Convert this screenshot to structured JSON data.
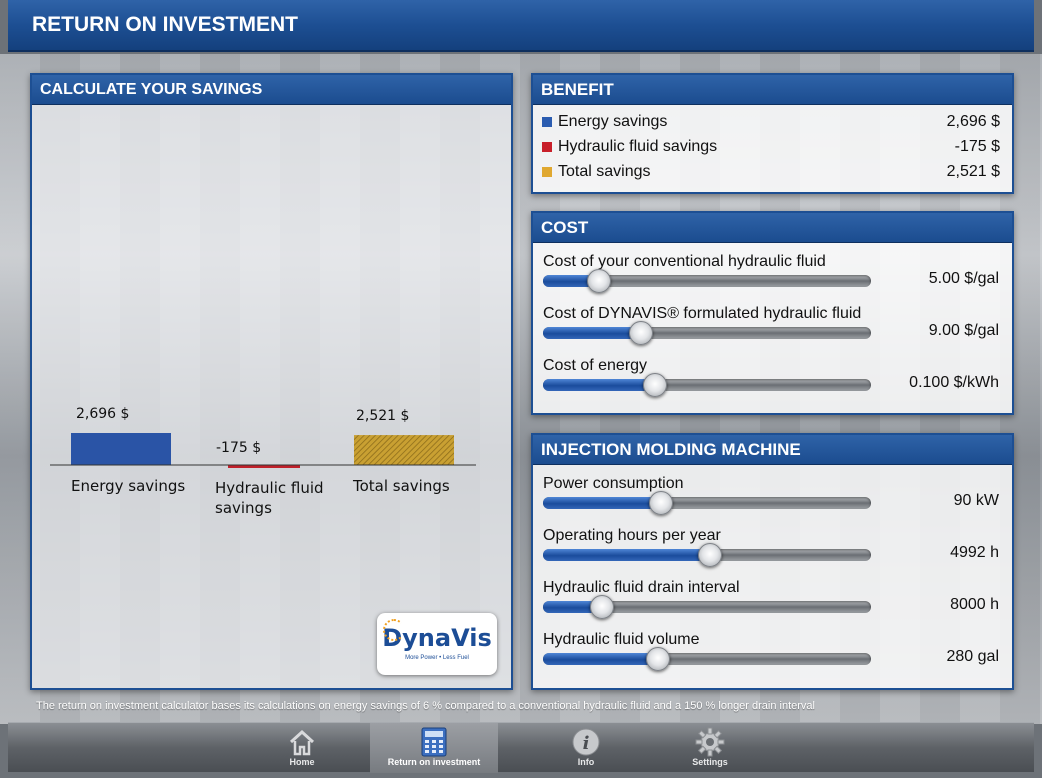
{
  "header": {
    "title": "RETURN ON INVESTMENT"
  },
  "calc": {
    "title": "CALCULATE YOUR SAVINGS",
    "logo": {
      "word": "DynaVis",
      "tagline": "More Power • Less Fuel"
    }
  },
  "chart_data": {
    "type": "bar",
    "categories": [
      "Energy savings",
      "Hydraulic fluid savings",
      "Total savings"
    ],
    "values": [
      2696,
      -175,
      2521
    ],
    "value_labels": [
      "2,696 $",
      "-175 $",
      "2,521 $"
    ],
    "category_labels": [
      "Energy savings",
      "Hydraulic fluid\nsavings",
      "Total savings"
    ],
    "colors": [
      "#2a54a6",
      "#c0202a",
      "#c9a032"
    ]
  },
  "benefit": {
    "title": "BENEFIT",
    "rows": [
      {
        "label": "Energy savings",
        "value": "2,696 $",
        "color": "#2a5cb0"
      },
      {
        "label": "Hydraulic fluid savings",
        "value": "-175 $",
        "color": "#c8202a"
      },
      {
        "label": "Total savings",
        "value": "2,521 $",
        "color": "#e0a830"
      }
    ]
  },
  "cost": {
    "title": "COST",
    "sliders": [
      {
        "label": "Cost of your conventional hydraulic fluid",
        "value": "5.00 $/gal",
        "level": 0.17
      },
      {
        "label": "Cost of DYNAVIS® formulated hydraulic fluid",
        "value": "9.00 $/gal",
        "level": 0.3
      },
      {
        "label": "Cost of energy",
        "value": "0.100 $/kWh",
        "level": 0.34
      }
    ]
  },
  "imm": {
    "title": "INJECTION MOLDING MACHINE",
    "sliders": [
      {
        "label": "Power consumption",
        "value": "90 kW",
        "level": 0.36
      },
      {
        "label": "Operating hours per year",
        "value": "4992 h",
        "level": 0.51
      },
      {
        "label": "Hydraulic fluid drain interval",
        "value": "8000 h",
        "level": 0.18
      },
      {
        "label": "Hydraulic fluid volume",
        "value": "280 gal",
        "level": 0.35
      }
    ]
  },
  "footnote": "The return on investment calculator bases its calculations on energy savings of 6 % compared to a conventional hydraulic fluid and a 150 % longer drain interval",
  "tabs": [
    {
      "label": "Home",
      "icon": "home-icon"
    },
    {
      "label": "Return on investment",
      "icon": "calculator-icon"
    },
    {
      "label": "Info",
      "icon": "info-icon"
    },
    {
      "label": "Settings",
      "icon": "gear-icon"
    }
  ]
}
